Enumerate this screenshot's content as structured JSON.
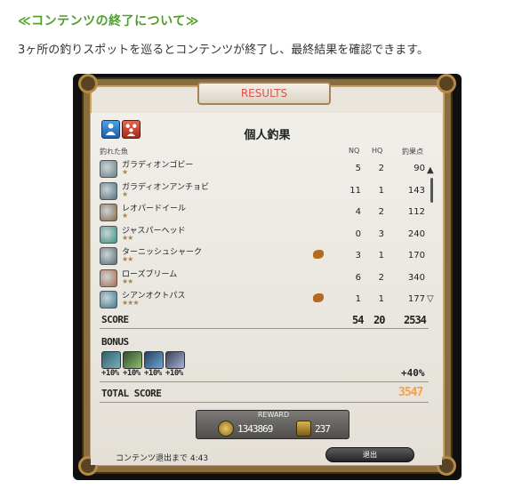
{
  "heading": "≪コンテンツの終了について≫",
  "intro": "3ヶ所の釣りスポットを巡るとコンテンツが終了し、最終結果を確認できます。",
  "window": {
    "tab_label": "RESULTS",
    "title": "個人釣果",
    "columns": {
      "fish": "釣れた魚",
      "nq": "NQ",
      "hq": "HQ",
      "points": "釣果点"
    },
    "rows": [
      {
        "name": "ガラディオンゴビー",
        "stars": "★",
        "nq": "5",
        "hq": "2",
        "points": "90",
        "icon_color": "#6b7f85",
        "bait": false
      },
      {
        "name": "ガラディオンアンチョビ",
        "stars": "★",
        "nq": "11",
        "hq": "1",
        "points": "143",
        "icon_color": "#56707a",
        "bait": false
      },
      {
        "name": "レオパードイール",
        "stars": "★",
        "nq": "4",
        "hq": "2",
        "points": "112",
        "icon_color": "#8a6b3f",
        "bait": false
      },
      {
        "name": "ジャスパーヘッド",
        "stars": "★★",
        "nq": "0",
        "hq": "3",
        "points": "240",
        "icon_color": "#3f8f83",
        "bait": false
      },
      {
        "name": "ターニッシュシャーク",
        "stars": "★★",
        "nq": "3",
        "hq": "1",
        "points": "170",
        "icon_color": "#5d6b73",
        "bait": true
      },
      {
        "name": "ローズブリーム",
        "stars": "★★",
        "nq": "6",
        "hq": "2",
        "points": "340",
        "icon_color": "#b06a4a",
        "bait": false
      },
      {
        "name": "シアンオクトパス",
        "stars": "★★★",
        "nq": "1",
        "hq": "1",
        "points": "177",
        "icon_color": "#3d7a8f",
        "bait": true
      }
    ],
    "score_label": "SCORE",
    "score": {
      "nq": "54",
      "hq": "20",
      "points": "2534"
    },
    "bonus_label": "BONUS",
    "bonuses": [
      "+10%",
      "+10%",
      "+10%",
      "+10%"
    ],
    "bonus_total": "+40%",
    "total_label": "TOTAL SCORE",
    "total_score": "3547",
    "reward": {
      "label": "REWARD",
      "gil": "1343869",
      "scrips": "237"
    },
    "footer": "コンテンツ退出まで 4:43",
    "exit_label": "退出"
  },
  "colors": {
    "heading": "#4f9e2a",
    "tab_text": "#d9534a",
    "total_score": "#f0a24a"
  }
}
